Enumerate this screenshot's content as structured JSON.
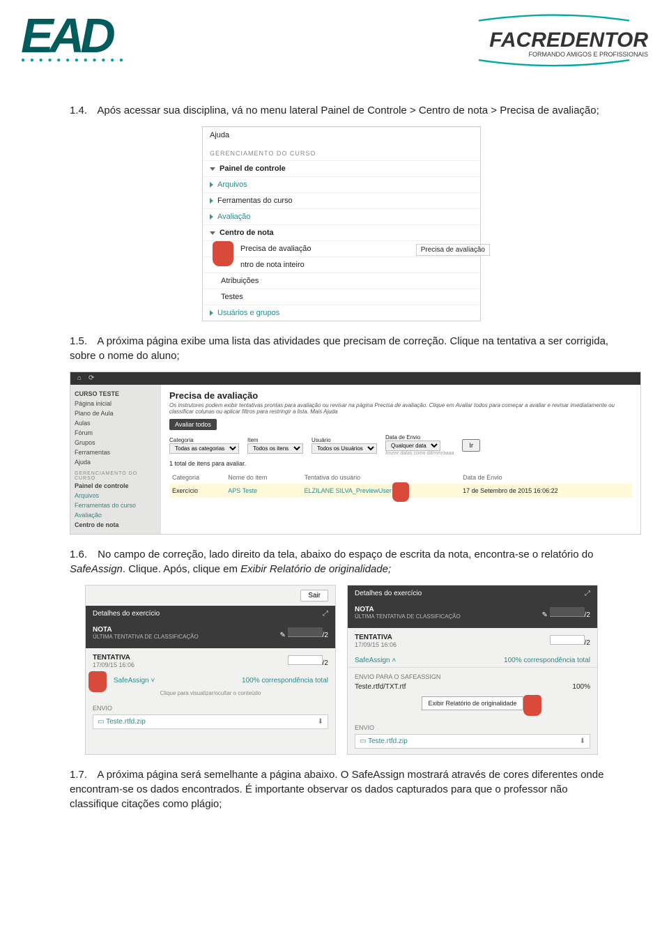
{
  "header": {
    "logo_ead": "EAD",
    "logo_fac_main": "FACREDENTOR",
    "logo_fac_tag": "FORMANDO AMIGOS E PROFISSIONAIS"
  },
  "sections": {
    "s14_num": "1.4.",
    "s14": "Após acessar sua disciplina, vá no menu lateral Painel de Controle > Centro de nota > Precisa de avaliação;",
    "s15_num": "1.5.",
    "s15": "A próxima página exibe uma lista das atividades que precisam de correção. Clique na tentativa a ser corrigida, sobre o nome do aluno;",
    "s16_num": "1.6.",
    "s16_a": "No campo de correção, lado direito da tela, abaixo do espaço de escrita da nota, encontra-se o relatório do ",
    "s16_b": "SafeAssign",
    "s16_c": ". Clique. Após, clique em ",
    "s16_d": "Exibir Relatório de originalidade;",
    "s17_num": "1.7.",
    "s17_a": "A próxima página será semelhante a página abaixo. O SafeAssign mostrará através de cores diferentes onde encontram-se os dados encontrados. É importante observar os dados capturados para que o professor não classifique citações como plágio;"
  },
  "shot1": {
    "ajuda": "Ajuda",
    "ger": "GERENCIAMENTO DO CURSO",
    "painel": "Painel de controle",
    "arquivos": "Arquivos",
    "ferramentas": "Ferramentas do curso",
    "avaliacao": "Avaliação",
    "centro": "Centro de nota",
    "precisa": "Precisa de avaliação",
    "inteiro": "ntro de nota inteiro",
    "atrib": "Atribuições",
    "testes": "Testes",
    "usuarios": "Usuários e grupos",
    "tooltip": "Precisa de avaliação"
  },
  "shot2": {
    "sidebar": {
      "curso": "CURSO TESTE",
      "pagina": "Página inicial",
      "plano": "Plano de Aula",
      "aulas": "Aulas",
      "forum": "Fórum",
      "grupos": "Grupos",
      "ferr": "Ferramentas",
      "ajuda": "Ajuda",
      "sec": "GERENCIAMENTO DO CURSO",
      "painel": "Painel de controle",
      "arquivos": "Arquivos",
      "ferrcurso": "Ferramentas do curso",
      "avaliacao": "Avaliação",
      "centro": "Centro de nota"
    },
    "title": "Precisa de avaliação",
    "intro": "Os instrutores podem exibir tentativas prontas para avaliação ou revisar na página Precisa de avaliação. Clique em Avaliar todos para começar a avaliar e revisar imediatamente ou classificar colunas ou aplicar filtros para restringir a lista. Mais Ajuda",
    "avaliar": "Avaliar todos",
    "filters": {
      "cat": "Categoria",
      "cat_v": "Todas as categorias",
      "item": "Item",
      "item_v": "Todos os itens",
      "user": "Usuário",
      "user_v": "Todos os Usuários",
      "data": "Data de Envio",
      "data_v": "Qualquer data",
      "hint": "Inserir datas como dd/mm/aaaa",
      "ir": "Ir"
    },
    "count": "1 total de itens para avaliar.",
    "th": {
      "cat": "Categoria",
      "nome": "Nome do item",
      "tent": "Tentativa do usuário",
      "data": "Data de Envio"
    },
    "row": {
      "cat": "Exercício",
      "nome": "APS Teste",
      "user": "ELZILANE SILVA_PreviewUser",
      "data": "17 de Setembro de 2015 16:06:22"
    }
  },
  "panelA": {
    "sair": "Sair",
    "det": "Detalhes do exercício",
    "nota": "NOTA",
    "sub": "ÚLTIMA TENTATIVA DE CLASSIFICAÇÃO",
    "max": "/2",
    "tent": "TENTATIVA",
    "date": "17/09/15 16:06",
    "sa": "SafeAssign",
    "pct": "100% correspondência total",
    "hint": "Clique para visualizar/ocultar o conteúdo",
    "envio": "ENVIO",
    "file": "Teste.rtfd.zip"
  },
  "panelB": {
    "det": "Detalhes do exercício",
    "nota": "NOTA",
    "sub": "ÚLTIMA TENTATIVA DE CLASSIFICAÇÃO",
    "max": "/2",
    "tent": "TENTATIVA",
    "date": "17/09/15 16:06",
    "sa": "SafeAssign",
    "pct": "100% correspondência total",
    "envsa": "ENVIO PARA O SAFEASSIGN",
    "file1": "Teste.rtfd/TXT.rtf",
    "file1pct": "100%",
    "btn": "Exibir Relatório de originalidade",
    "envio": "ENVIO",
    "file2": "Teste.rtfd.zip"
  }
}
